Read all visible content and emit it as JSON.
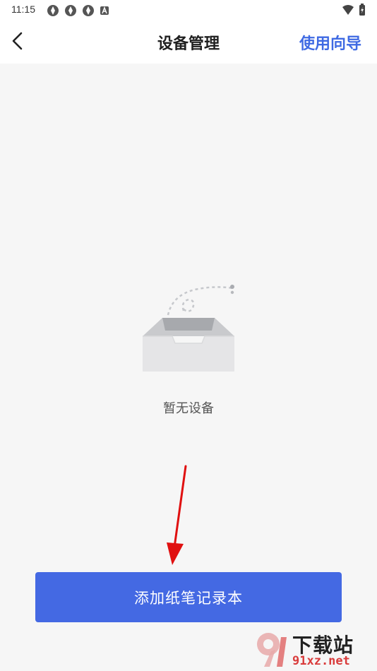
{
  "status_bar": {
    "time": "11:15",
    "left_icons": [
      "sync-icon",
      "sync-icon",
      "sync-icon",
      "app-badge-icon"
    ],
    "right_icons": [
      "wifi-icon",
      "battery-charging-icon"
    ]
  },
  "header": {
    "title": "设备管理",
    "back_icon": "chevron-left-icon",
    "guide_label": "使用向导"
  },
  "empty_state": {
    "icon": "empty-inbox-icon",
    "message": "暂无设备"
  },
  "primary_action": {
    "label": "添加纸笔记录本"
  },
  "watermark": {
    "title": "下载站",
    "url": "91xz.net"
  },
  "colors": {
    "accent": "#4469e3",
    "link": "#3f6ae3",
    "background": "#f6f6f6",
    "annotation_arrow": "#e01010",
    "watermark_red": "#d93b3b"
  }
}
